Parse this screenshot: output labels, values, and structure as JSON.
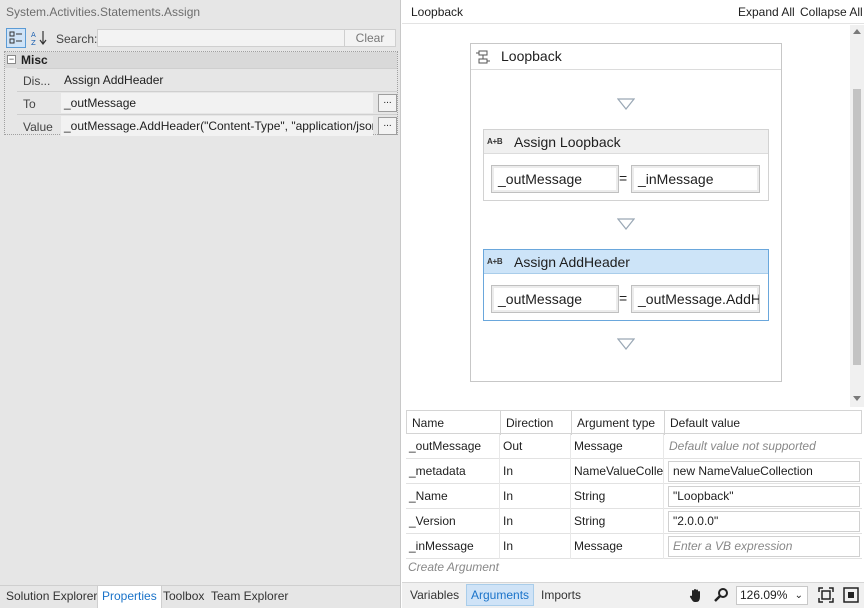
{
  "properties": {
    "type_name": "System.Activities.Statements.Assign",
    "search_label": "Search:",
    "search_value": "",
    "clear_label": "Clear",
    "category": "Misc",
    "rows": [
      {
        "name": "Dis...",
        "value": "Assign AddHeader"
      },
      {
        "name": "To",
        "value": "_outMessage"
      },
      {
        "name": "Value",
        "value": "_outMessage.AddHeader(\"Content-Type\", \"application/json\")"
      }
    ],
    "ellipsis_label": "..."
  },
  "left_tabs": [
    "Solution Explorer",
    "Properties",
    "Toolbox",
    "Team Explorer"
  ],
  "designer": {
    "breadcrumb": "Loopback",
    "expand_all": "Expand All",
    "collapse_all": "Collapse All",
    "sequence_title": "Loopback",
    "assign_icon_text": "A+B",
    "equals": "=",
    "activities": [
      {
        "title": "Assign Loopback",
        "to": "_outMessage",
        "value": "_inMessage"
      },
      {
        "title": "Assign AddHeader",
        "to": "_outMessage",
        "value": "_outMessage.AddHeader"
      }
    ]
  },
  "arguments": {
    "columns": [
      "Name",
      "Direction",
      "Argument type",
      "Default value"
    ],
    "rows": [
      {
        "name": "_outMessage",
        "direction": "Out",
        "type": "Message",
        "default": "Default value not supported"
      },
      {
        "name": "_metadata",
        "direction": "In",
        "type": "NameValueCollection",
        "default": "new NameValueCollection"
      },
      {
        "name": "_Name",
        "direction": "In",
        "type": "String",
        "default": "\"Loopback\""
      },
      {
        "name": "_Version",
        "direction": "In",
        "type": "String",
        "default": "\"2.0.0.0\""
      },
      {
        "name": "_inMessage",
        "direction": "In",
        "type": "Message",
        "default": "Enter a VB expression"
      }
    ],
    "create_label": "Create Argument"
  },
  "bottom_tabs": [
    "Variables",
    "Arguments",
    "Imports"
  ],
  "zoom": "126.09%",
  "colors": {
    "accent": "#1a73c9",
    "selected_header": "#cde4f8"
  }
}
